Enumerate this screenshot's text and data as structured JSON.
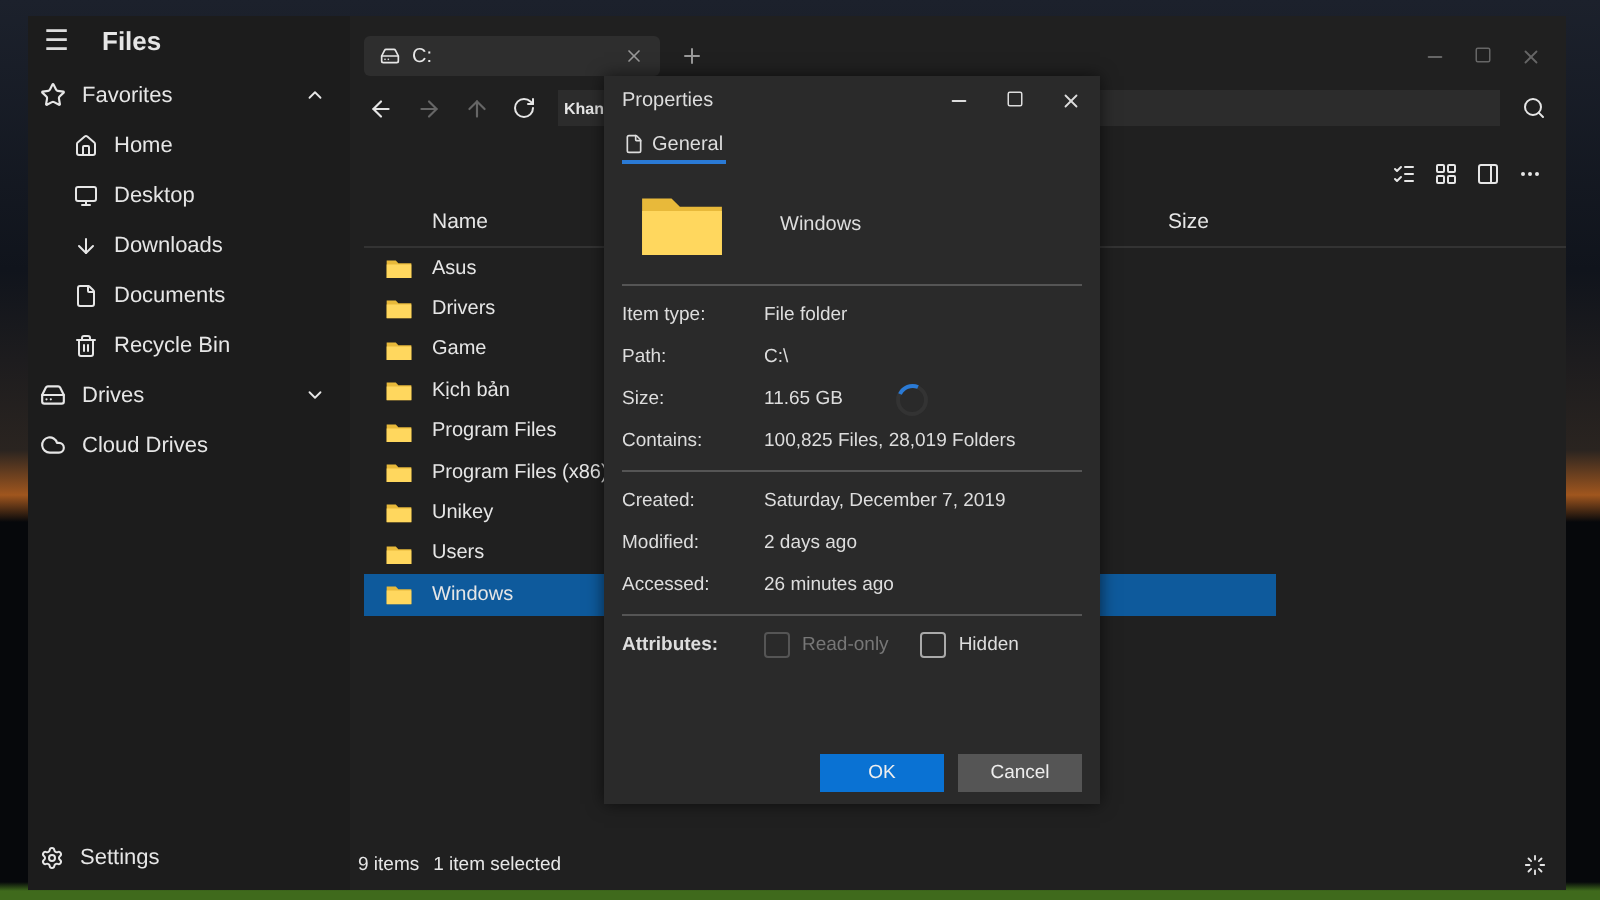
{
  "app": {
    "title": "Files",
    "menu_glyph": "☰"
  },
  "sidebar": {
    "sections": [
      {
        "label": "Favorites",
        "expanded": true,
        "children": [
          {
            "label": "Home"
          },
          {
            "label": "Desktop"
          },
          {
            "label": "Downloads"
          },
          {
            "label": "Documents"
          },
          {
            "label": "Recycle Bin"
          }
        ]
      },
      {
        "label": "Drives",
        "expanded": false
      },
      {
        "label": "Cloud Drives"
      }
    ],
    "settings": "Settings"
  },
  "tabs": [
    {
      "label": "C:",
      "selected": true
    }
  ],
  "address": {
    "value": "Khan"
  },
  "table": {
    "columns": [
      "Name",
      "Size"
    ],
    "rows": [
      {
        "name": "Asus",
        "selected": false
      },
      {
        "name": "Drivers",
        "selected": false
      },
      {
        "name": "Game",
        "selected": false
      },
      {
        "name": "Kịch bản",
        "selected": false
      },
      {
        "name": "Program Files",
        "selected": false
      },
      {
        "name": "Program Files (x86)",
        "selected": false
      },
      {
        "name": "Unikey",
        "selected": false
      },
      {
        "name": "Users",
        "selected": false
      },
      {
        "name": "Windows",
        "selected": true
      }
    ]
  },
  "status_bar": {
    "count": "9 items",
    "selection": "1 item selected"
  },
  "dialog": {
    "title": "Properties",
    "tabs": [
      {
        "label": "General",
        "selected": true
      }
    ],
    "item_name": "Windows",
    "groups": [
      [
        {
          "label": "Item type:",
          "value": "File folder"
        },
        {
          "label": "Path:",
          "value": "C:\\"
        },
        {
          "label": "Size:",
          "value": "11.65 GB",
          "loading": true
        },
        {
          "label": "Contains:",
          "value": "100,825 Files, 28,019 Folders"
        }
      ],
      [
        {
          "label": "Created:",
          "value": "Saturday, December 7, 2019"
        },
        {
          "label": "Modified:",
          "value": "2 days ago"
        },
        {
          "label": "Accessed:",
          "value": "26 minutes ago"
        }
      ]
    ],
    "attributes": {
      "label": "Attributes:",
      "options": [
        {
          "label": "Read-only",
          "checked": false,
          "disabled": true
        },
        {
          "label": "Hidden",
          "checked": false,
          "disabled": false
        }
      ]
    },
    "buttons": [
      {
        "label": "OK",
        "kind": "primary"
      },
      {
        "label": "Cancel",
        "kind": "secondary"
      }
    ]
  }
}
